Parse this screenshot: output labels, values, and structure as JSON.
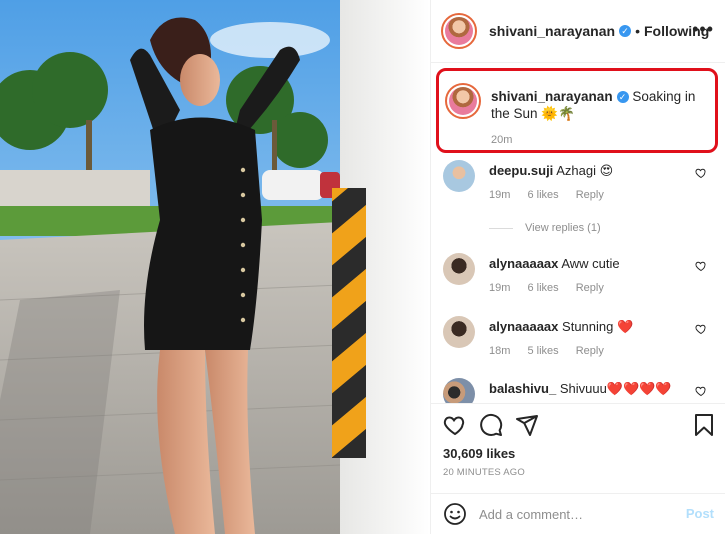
{
  "header": {
    "username": "shivani_narayanan",
    "separator": "•",
    "follow_status": "Following",
    "more_label": "•••"
  },
  "caption": {
    "username": "shivani_narayanan",
    "text": "Soaking in the Sun 🌞🌴",
    "time": "20m"
  },
  "comments": [
    {
      "username": "deepu.suji",
      "text": "Azhagi 😍",
      "time": "19m",
      "likes": "6 likes",
      "reply": "Reply"
    },
    {
      "username": "alynaaaaax",
      "text": "Aww cutie",
      "time": "19m",
      "likes": "6 likes",
      "reply": "Reply"
    },
    {
      "username": "alynaaaaax",
      "text": "Stunning ❤️",
      "time": "18m",
      "likes": "5 likes",
      "reply": "Reply"
    },
    {
      "username": "balashivu_",
      "text": "Shivuuu❤️❤️❤️❤️"
    }
  ],
  "view_replies": "View replies (1)",
  "actions": {
    "likes": "30,609 likes",
    "time_ago": "20 MINUTES AGO"
  },
  "add_comment": {
    "placeholder": "Add a comment…",
    "post_label": "Post"
  },
  "colors": {
    "verified": "#3897f0",
    "highlight_border": "#e0101b",
    "post_disabled": "#b2dffc",
    "meta_text": "#8e8e8e"
  },
  "icons": [
    "verified-badge-icon",
    "more-options-icon",
    "heart-icon",
    "comment-icon",
    "share-icon",
    "bookmark-icon",
    "emoji-icon"
  ]
}
